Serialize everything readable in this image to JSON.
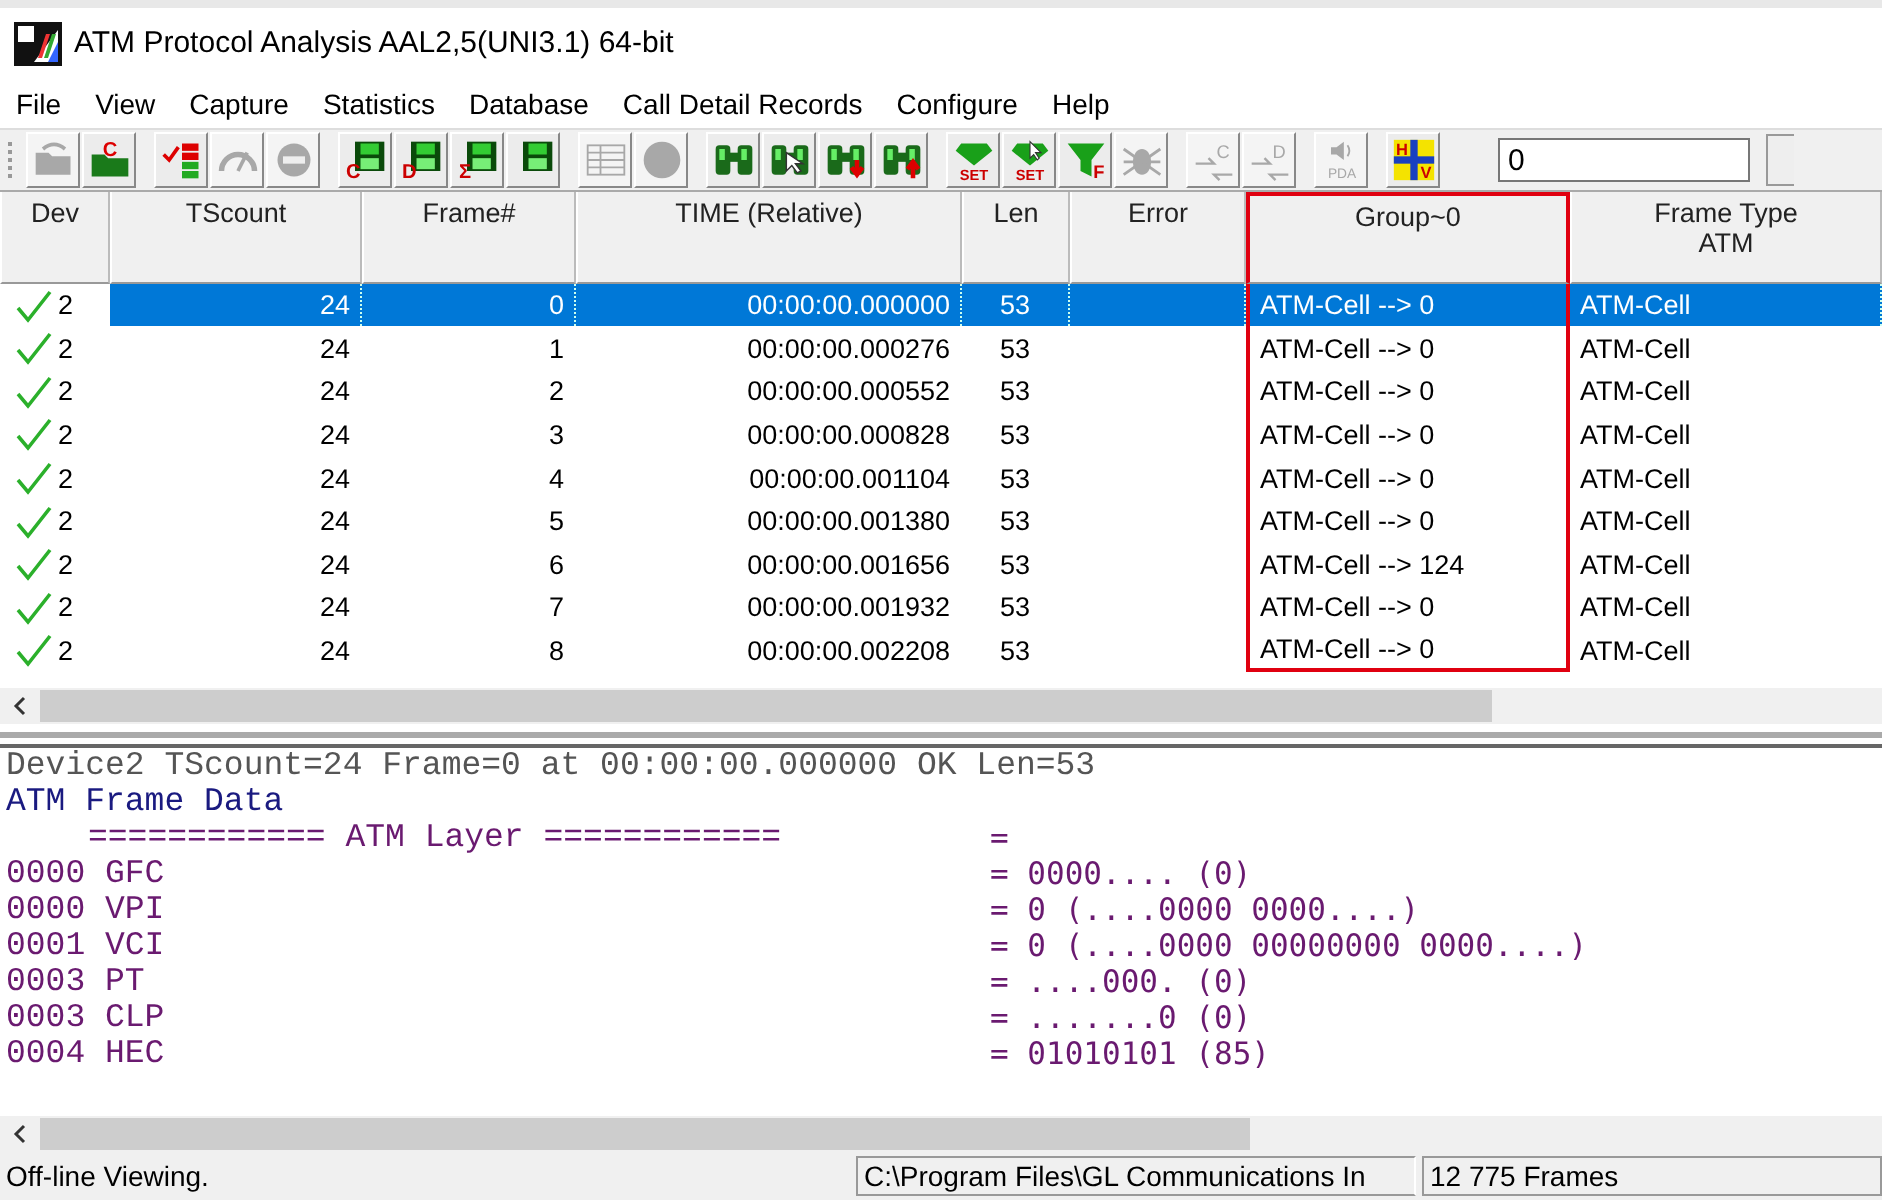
{
  "window": {
    "title": "ATM Protocol Analysis AAL2,5(UNI3.1) 64-bit"
  },
  "menu": [
    "File",
    "View",
    "Capture",
    "Statistics",
    "Database",
    "Call Detail Records",
    "Configure",
    "Help"
  ],
  "toolbar": {
    "groups": [
      [
        {
          "kind": "open",
          "disabled": true
        },
        {
          "kind": "folder",
          "glyph": "C",
          "disabled": false
        }
      ],
      [
        {
          "kind": "checklist",
          "disabled": false
        },
        {
          "kind": "gauge",
          "disabled": true
        },
        {
          "kind": "stop",
          "disabled": true
        }
      ],
      [
        {
          "kind": "floppy",
          "glyph": "C",
          "disabled": false
        },
        {
          "kind": "floppy",
          "glyph": "D",
          "disabled": false
        },
        {
          "kind": "floppy",
          "glyph": "Σ",
          "disabled": false
        },
        {
          "kind": "floppy",
          "disabled": false
        }
      ],
      [
        {
          "kind": "table",
          "disabled": true
        },
        {
          "kind": "circle",
          "disabled": true
        }
      ],
      [
        {
          "kind": "binoculars",
          "disabled": false
        },
        {
          "kind": "binoculars-pointer",
          "disabled": false
        },
        {
          "kind": "binoculars-down",
          "disabled": false
        },
        {
          "kind": "binoculars-up",
          "disabled": false
        }
      ],
      [
        {
          "kind": "gem",
          "glyph": "SET",
          "disabled": false
        },
        {
          "kind": "gem-pointer",
          "glyph": "SET",
          "disabled": false
        },
        {
          "kind": "funnel",
          "glyph": "F",
          "disabled": false
        },
        {
          "kind": "bug",
          "disabled": true
        }
      ],
      [
        {
          "kind": "swap",
          "glyph": "C",
          "disabled": true
        },
        {
          "kind": "swap",
          "glyph": "D",
          "disabled": true
        }
      ],
      [
        {
          "kind": "speaker",
          "glyph": "PDA",
          "disabled": true
        }
      ],
      [
        {
          "kind": "hv",
          "glyph": "H",
          "glyph2": "V",
          "disabled": false
        }
      ]
    ],
    "field": {
      "value": "0"
    }
  },
  "table": {
    "columns": [
      {
        "label": "Dev"
      },
      {
        "label": "TScount"
      },
      {
        "label": "Frame#"
      },
      {
        "label": "TIME (Relative)"
      },
      {
        "label": "Len"
      },
      {
        "label": "Error"
      },
      {
        "label": "Group~0",
        "highlighted": true
      },
      {
        "label": "Frame Type",
        "sublabel": "ATM"
      }
    ],
    "rows": [
      {
        "selected": true,
        "valid": true,
        "dev": "2",
        "tscount": "24",
        "frame": "0",
        "time": "00:00:00.000000",
        "len": "53",
        "group": "ATM-Cell --> 0",
        "frame_type": "ATM-Cell"
      },
      {
        "selected": false,
        "valid": true,
        "dev": "2",
        "tscount": "24",
        "frame": "1",
        "time": "00:00:00.000276",
        "len": "53",
        "group": "ATM-Cell --> 0",
        "frame_type": "ATM-Cell"
      },
      {
        "selected": false,
        "valid": true,
        "dev": "2",
        "tscount": "24",
        "frame": "2",
        "time": "00:00:00.000552",
        "len": "53",
        "group": "ATM-Cell --> 0",
        "frame_type": "ATM-Cell"
      },
      {
        "selected": false,
        "valid": true,
        "dev": "2",
        "tscount": "24",
        "frame": "3",
        "time": "00:00:00.000828",
        "len": "53",
        "group": "ATM-Cell --> 0",
        "frame_type": "ATM-Cell"
      },
      {
        "selected": false,
        "valid": true,
        "dev": "2",
        "tscount": "24",
        "frame": "4",
        "time": "00:00:00.001104",
        "len": "53",
        "group": "ATM-Cell --> 0",
        "frame_type": "ATM-Cell"
      },
      {
        "selected": false,
        "valid": true,
        "dev": "2",
        "tscount": "24",
        "frame": "5",
        "time": "00:00:00.001380",
        "len": "53",
        "group": "ATM-Cell --> 0",
        "frame_type": "ATM-Cell"
      },
      {
        "selected": false,
        "valid": true,
        "dev": "2",
        "tscount": "24",
        "frame": "6",
        "time": "00:00:00.001656",
        "len": "53",
        "group": "ATM-Cell --> 124",
        "frame_type": "ATM-Cell"
      },
      {
        "selected": false,
        "valid": true,
        "dev": "2",
        "tscount": "24",
        "frame": "7",
        "time": "00:00:00.001932",
        "len": "53",
        "group": "ATM-Cell --> 0",
        "frame_type": "ATM-Cell"
      },
      {
        "selected": false,
        "valid": true,
        "dev": "2",
        "tscount": "24",
        "frame": "8",
        "time": "00:00:00.002208",
        "len": "53",
        "group": "ATM-Cell --> 0",
        "frame_type": "ATM-Cell"
      }
    ]
  },
  "detail": {
    "lines": [
      {
        "kind": "summary",
        "text": "Device2 TScount=24 Frame=0 at 00:00:00.000000 OK Len=53"
      },
      {
        "kind": "section",
        "text": "ATM Frame Data"
      },
      {
        "kind": "layer",
        "text": "============ ATM Layer ============",
        "value": "="
      },
      {
        "kind": "field",
        "text": "0000 GFC",
        "value": "= 0000.... (0)"
      },
      {
        "kind": "field",
        "text": "0000 VPI",
        "value": "= 0 (....0000 0000....)"
      },
      {
        "kind": "field",
        "text": "0001 VCI",
        "value": "= 0 (....0000 00000000 0000....)"
      },
      {
        "kind": "field",
        "text": "0003 PT",
        "value": "= ....000. (0)"
      },
      {
        "kind": "field",
        "text": "0003 CLP",
        "value": "= .......0 (0)"
      },
      {
        "kind": "field",
        "text": "0004 HEC",
        "value": "= 01010101 (85)"
      }
    ]
  },
  "status_bar": [
    "Off-line Viewing.",
    "C:\\Program Files\\GL Communications In",
    "12 775 Frames"
  ]
}
